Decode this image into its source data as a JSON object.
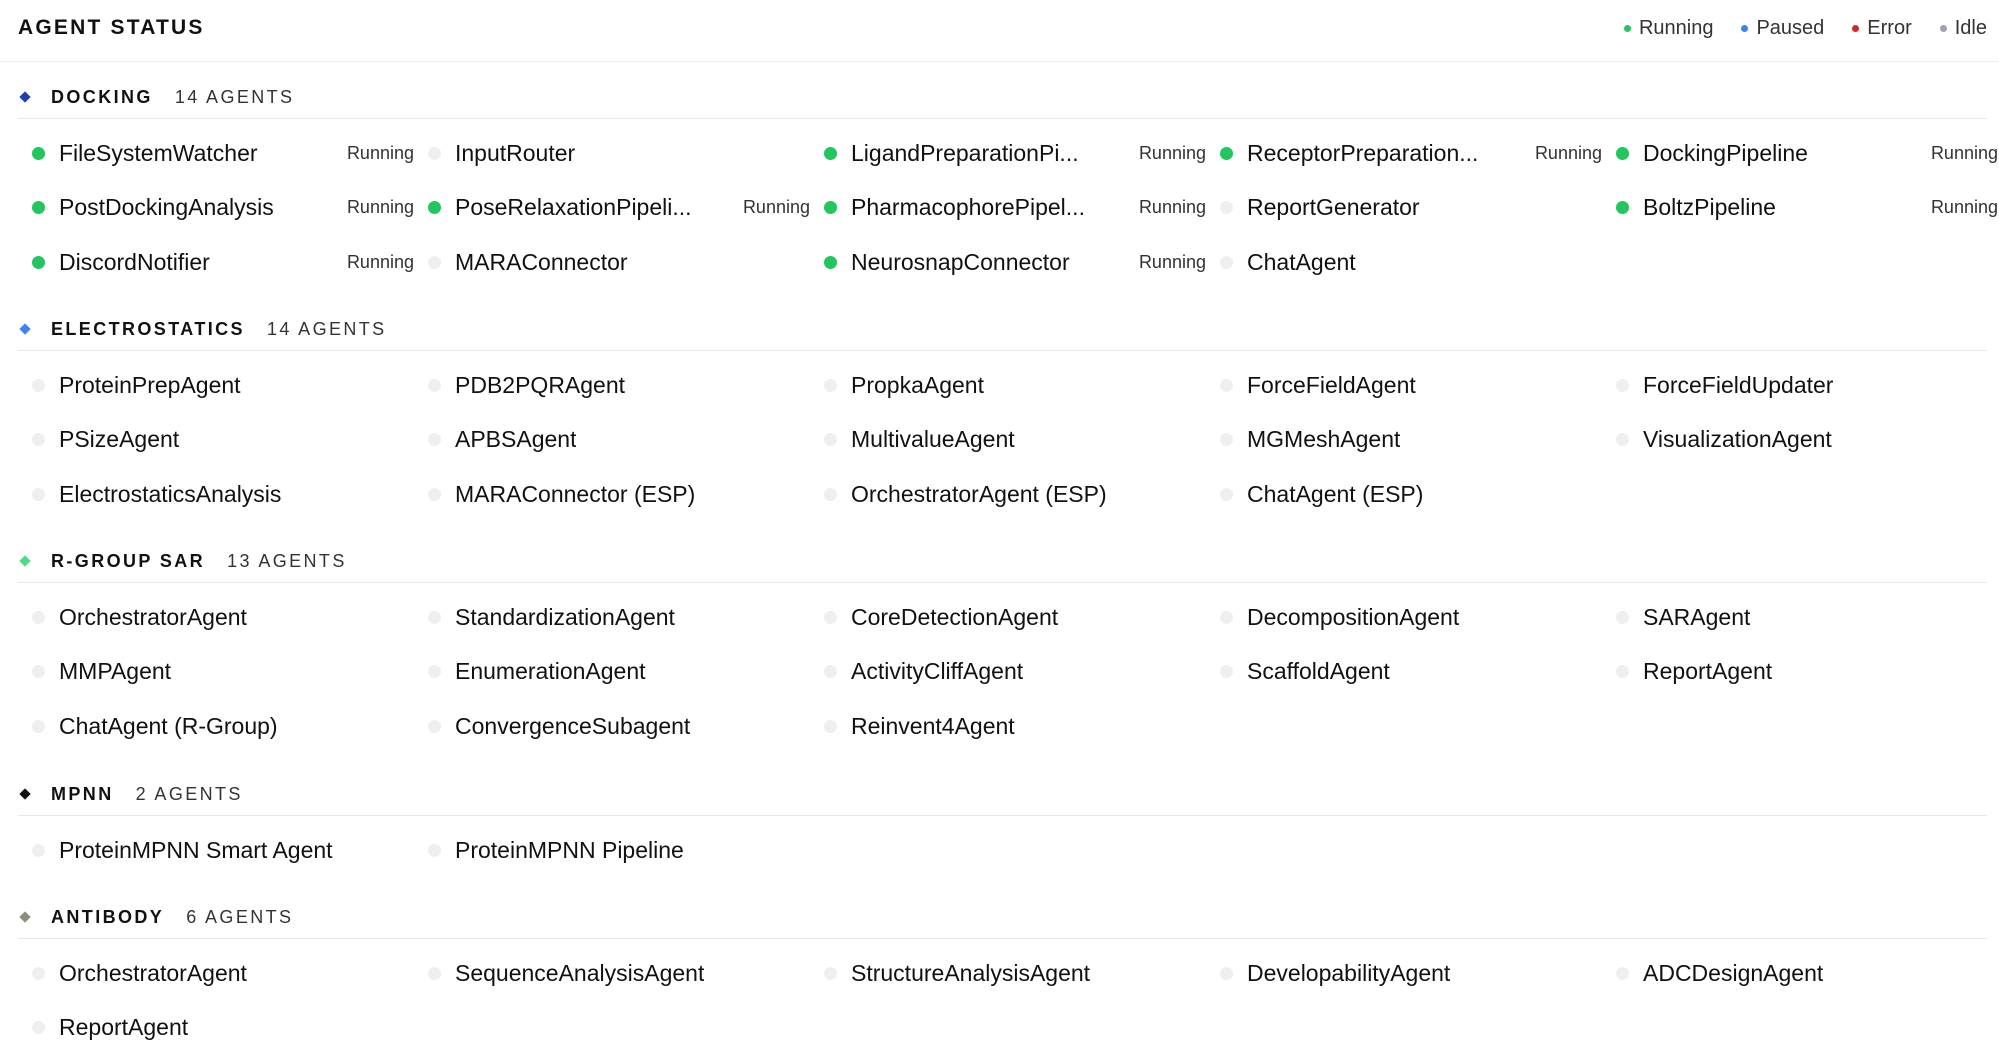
{
  "header": {
    "title": "AGENT STATUS",
    "legend": [
      {
        "label": "Running",
        "color": "#22c55e",
        "icon": "status-dot"
      },
      {
        "label": "Paused",
        "color": "#3b82f6",
        "icon": "status-dot"
      },
      {
        "label": "Error",
        "color": "#dc2626",
        "icon": "status-dot"
      },
      {
        "label": "Idle",
        "color": "#9ca3af",
        "icon": "status-dot"
      }
    ]
  },
  "sections": [
    {
      "title": "DOCKING",
      "count_label": "14 AGENTS",
      "color": "#1e40af",
      "icon": "diamond-icon",
      "agents": [
        {
          "name": "FileSystemWatcher",
          "status": "Running"
        },
        {
          "name": "InputRouter",
          "status": ""
        },
        {
          "name": "LigandPreparationPi...",
          "status": "Running"
        },
        {
          "name": "ReceptorPreparation...",
          "status": "Running"
        },
        {
          "name": "DockingPipeline",
          "status": "Running"
        },
        {
          "name": "PostDockingAnalysis",
          "status": "Running"
        },
        {
          "name": "PoseRelaxationPipeli...",
          "status": "Running"
        },
        {
          "name": "PharmacophorePipel...",
          "status": "Running"
        },
        {
          "name": "ReportGenerator",
          "status": ""
        },
        {
          "name": "BoltzPipeline",
          "status": "Running"
        },
        {
          "name": "DiscordNotifier",
          "status": "Running"
        },
        {
          "name": "MARAConnector",
          "status": ""
        },
        {
          "name": "NeurosnapConnector",
          "status": "Running"
        },
        {
          "name": "ChatAgent",
          "status": ""
        }
      ]
    },
    {
      "title": "ELECTROSTATICS",
      "count_label": "14 AGENTS",
      "color": "#3b82f6",
      "icon": "diamond-icon",
      "agents": [
        {
          "name": "ProteinPrepAgent",
          "status": ""
        },
        {
          "name": "PDB2PQRAgent",
          "status": ""
        },
        {
          "name": "PropkaAgent",
          "status": ""
        },
        {
          "name": "ForceFieldAgent",
          "status": ""
        },
        {
          "name": "ForceFieldUpdater",
          "status": ""
        },
        {
          "name": "PSizeAgent",
          "status": ""
        },
        {
          "name": "APBSAgent",
          "status": ""
        },
        {
          "name": "MultivalueAgent",
          "status": ""
        },
        {
          "name": "MGMeshAgent",
          "status": ""
        },
        {
          "name": "VisualizationAgent",
          "status": ""
        },
        {
          "name": "ElectrostaticsAnalysis",
          "status": ""
        },
        {
          "name": "MARAConnector (ESP)",
          "status": ""
        },
        {
          "name": "OrchestratorAgent (ESP)",
          "status": ""
        },
        {
          "name": "ChatAgent (ESP)",
          "status": ""
        }
      ]
    },
    {
      "title": "R-GROUP SAR",
      "count_label": "13 AGENTS",
      "color": "#4ade80",
      "icon": "diamond-icon",
      "agents": [
        {
          "name": "OrchestratorAgent",
          "status": ""
        },
        {
          "name": "StandardizationAgent",
          "status": ""
        },
        {
          "name": "CoreDetectionAgent",
          "status": ""
        },
        {
          "name": "DecompositionAgent",
          "status": ""
        },
        {
          "name": "SARAgent",
          "status": ""
        },
        {
          "name": "MMPAgent",
          "status": ""
        },
        {
          "name": "EnumerationAgent",
          "status": ""
        },
        {
          "name": "ActivityCliffAgent",
          "status": ""
        },
        {
          "name": "ScaffoldAgent",
          "status": ""
        },
        {
          "name": "ReportAgent",
          "status": ""
        },
        {
          "name": "ChatAgent (R-Group)",
          "status": ""
        },
        {
          "name": "ConvergenceSubagent",
          "status": ""
        },
        {
          "name": "Reinvent4Agent",
          "status": ""
        }
      ]
    },
    {
      "title": "MPNN",
      "count_label": "2 AGENTS",
      "color": "#111111",
      "icon": "diamond-icon",
      "agents": [
        {
          "name": "ProteinMPNN Smart Agent",
          "status": ""
        },
        {
          "name": "ProteinMPNN Pipeline",
          "status": ""
        }
      ]
    },
    {
      "title": "ANTIBODY",
      "count_label": "6 AGENTS",
      "color": "#8a8f73",
      "icon": "diamond-icon",
      "agents": [
        {
          "name": "OrchestratorAgent",
          "status": ""
        },
        {
          "name": "SequenceAnalysisAgent",
          "status": ""
        },
        {
          "name": "StructureAnalysisAgent",
          "status": ""
        },
        {
          "name": "DevelopabilityAgent",
          "status": ""
        },
        {
          "name": "ADCDesignAgent",
          "status": ""
        },
        {
          "name": "ReportAgent",
          "status": ""
        }
      ]
    }
  ]
}
